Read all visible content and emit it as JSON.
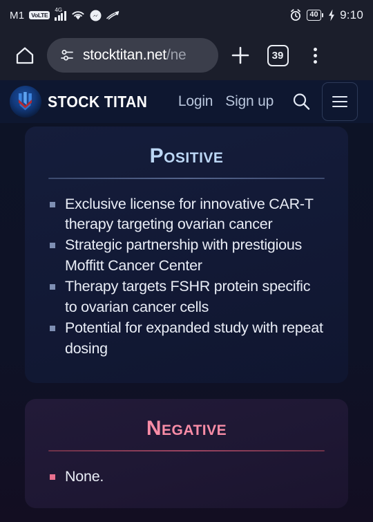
{
  "status_bar": {
    "carrier": "M1",
    "volte_badge": "VoLTE",
    "network_type": "4G",
    "icons": [
      "signal-icon",
      "wifi-icon",
      "messenger-icon",
      "strava-icon",
      "alarm-icon"
    ],
    "battery_percent": "40",
    "time": "9:10"
  },
  "browser": {
    "home_icon": "home-icon",
    "site_settings_icon": "tune-icon",
    "url_visible": "stocktitan.net",
    "url_dim": "/ne",
    "new_tab_label": "+",
    "tab_count": "39",
    "menu_icon": "overflow-menu-icon"
  },
  "site_header": {
    "brand": "STOCK TITAN",
    "logo_icon": "stock-titan-logo",
    "login_label": "Login",
    "signup_label": "Sign up",
    "search_icon": "search-icon",
    "menu_icon": "hamburger-menu-icon"
  },
  "content": {
    "positive": {
      "title": "Positive",
      "items": [
        "Exclusive license for innovative CAR-T therapy targeting ovarian cancer",
        "Strategic partnership with prestigious Moffitt Cancer Center",
        "Therapy targets FSHR protein specific to ovarian cancer cells",
        "Potential for expanded study with repeat dosing"
      ]
    },
    "negative": {
      "title": "Negative",
      "items": [
        "None."
      ]
    }
  },
  "colors": {
    "positive_accent": "#bcd7f5",
    "negative_accent": "#f98ca6",
    "page_bg": "#0d1326",
    "header_bg": "#0e1730",
    "chrome_bg": "#1b1e2b"
  }
}
